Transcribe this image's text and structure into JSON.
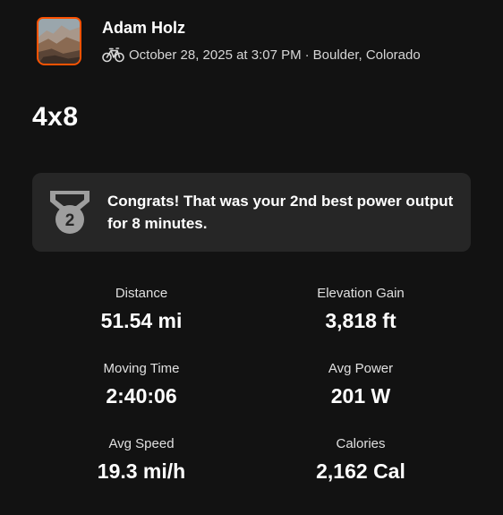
{
  "athlete": {
    "name": "Adam Holz",
    "activity_icon": "bike-icon",
    "datetime": "October 28, 2025 at 3:07 PM",
    "separator": "·",
    "location": "Boulder, Colorado"
  },
  "activity": {
    "title": "4x8"
  },
  "achievement": {
    "icon": "medal-icon",
    "rank": "2",
    "message": "Congrats! That was your 2nd best power output for 8 minutes."
  },
  "stats": [
    {
      "label": "Distance",
      "value": "51.54 mi"
    },
    {
      "label": "Elevation Gain",
      "value": "3,818 ft"
    },
    {
      "label": "Moving Time",
      "value": "2:40:06"
    },
    {
      "label": "Avg Power",
      "value": "201 W"
    },
    {
      "label": "Avg Speed",
      "value": "19.3 mi/h"
    },
    {
      "label": "Calories",
      "value": "2,162 Cal"
    }
  ],
  "colors": {
    "background": "#121212",
    "card": "#262626",
    "accent": "#fc5200",
    "medal": "#9e9e9e"
  }
}
